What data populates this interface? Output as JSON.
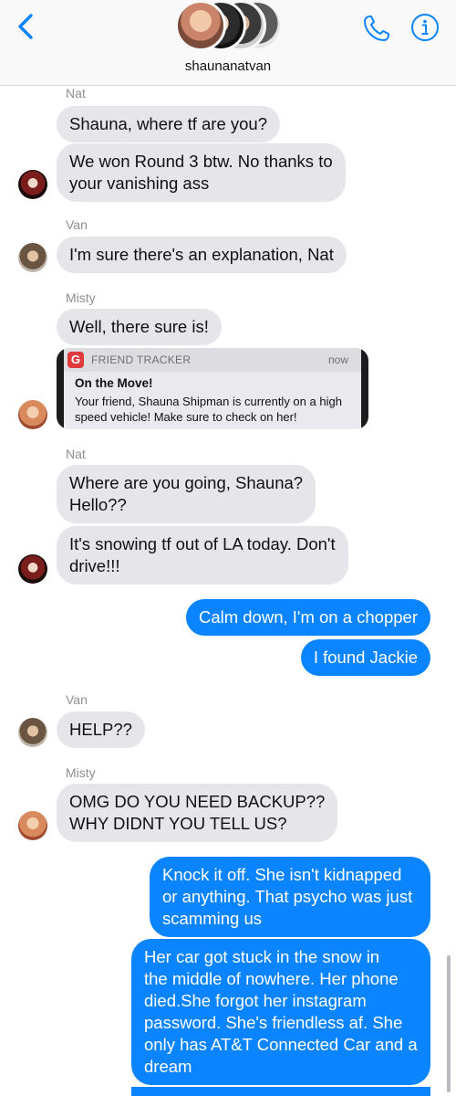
{
  "header": {
    "title": "shaunanatvan",
    "back_icon": "chevron-left-icon",
    "call_icon": "phone-icon",
    "info_icon": "info-icon",
    "accent": "#0a84ff"
  },
  "messages": {
    "nat_label_1": "Nat",
    "nat_msg_1": "Shauna, where tf are you?",
    "nat_msg_2": "We won Round 3 btw. No thanks to\nyour vanishing ass",
    "van_label_1": "Van",
    "van_msg_1": "I'm sure there's an explanation, Nat",
    "misty_label_1": "Misty",
    "misty_msg_1": "Well, there sure is!",
    "notification": {
      "app": "FRIEND TRACKER",
      "time": "now",
      "title": "On the Move!",
      "body": "Your friend, Shauna Shipman is currently on a high speed vehicle! Make sure to check on her!"
    },
    "nat_label_2": "Nat",
    "nat_msg_3": "Where are you going, Shauna?\nHello??",
    "nat_msg_4": "It's snowing tf out of LA today. Don't\ndrive!!!",
    "me_msg_1": "Calm down, I'm on a chopper",
    "me_msg_2": "I found Jackie",
    "van_label_2": "Van",
    "van_msg_2": "HELP??",
    "misty_label_2": "Misty",
    "misty_msg_2": "OMG DO YOU NEED BACKUP??\nWHY DIDNT YOU TELL US?",
    "me_msg_3": "Knock it off. She isn't kidnapped\nor anything. That psycho was just\nscamming us",
    "me_msg_4": "Her car got stuck in the snow in\nthe middle of nowhere. Her phone\ndied.She forgot her instagram\npassword. She's friendless af. She\nonly has AT&T Connected Car and a\ndream"
  },
  "colors": {
    "incoming_bubble": "#e5e5ea",
    "outgoing_bubble": "#0a84ff",
    "notification_badge": "#e0393e"
  }
}
